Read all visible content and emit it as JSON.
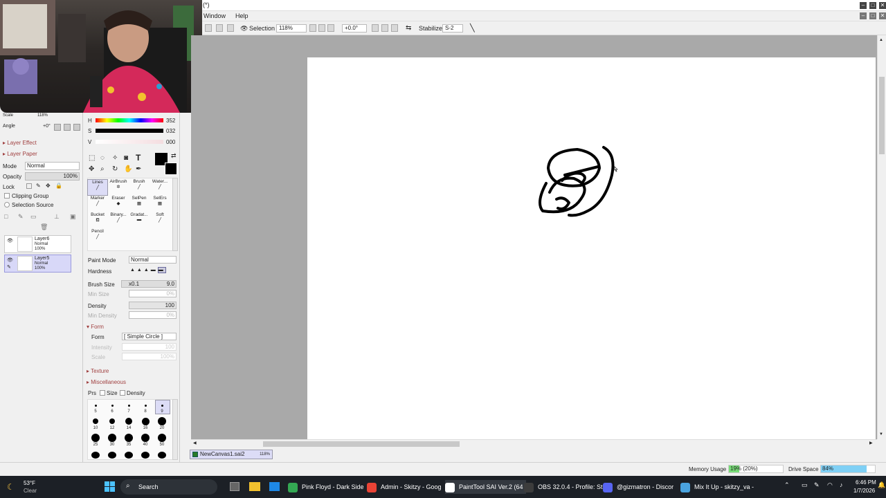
{
  "window": {
    "title_suffix": "(*)"
  },
  "menu": {
    "window": "Window",
    "help": "Help"
  },
  "toolbar": {
    "selection": "Selection",
    "zoom": "118%",
    "rotation": "+0.0°",
    "stabilizer_label": "Stabilizer",
    "stabilizer_value": "S-2"
  },
  "navigator": {
    "scale_label": "Scale",
    "scale_value": "118%",
    "angle_label": "Angle",
    "angle_value": "+0°"
  },
  "layer_panel": {
    "layer_effect": "Layer Effect",
    "layer_paper": "Layer Paper",
    "mode_label": "Mode",
    "mode_value": "Normal",
    "opacity_label": "Opacity",
    "opacity_value": "100%",
    "lock_label": "Lock",
    "clipping_group": "Clipping Group",
    "selection_source": "Selection Source",
    "layers": [
      {
        "name": "Layer6",
        "mode": "Normal",
        "opacity": "100%"
      },
      {
        "name": "Layer5",
        "mode": "Normal",
        "opacity": "100%"
      }
    ]
  },
  "color": {
    "h_label": "H",
    "h": "352",
    "s_label": "S",
    "s": "032",
    "v_label": "V",
    "v": "000",
    "primary": "#000000"
  },
  "tools": {
    "row1": [
      "Lines",
      "AirBrush",
      "Brush",
      "Water..."
    ],
    "row2": [
      "Marker",
      "Eraser",
      "SelPen",
      "SelErs"
    ],
    "row3": [
      "Bucket",
      "Binary...",
      "Gradat...",
      "Soft"
    ],
    "row4": [
      "Pencil"
    ]
  },
  "brush_settings": {
    "paint_mode_label": "Paint Mode",
    "paint_mode_value": "Normal",
    "hardness_label": "Hardness",
    "brush_size_label": "Brush Size",
    "brush_size_mult": "x0.1",
    "brush_size_value": "9.0",
    "min_size_label": "Min Size",
    "min_size_value": "0%",
    "density_label": "Density",
    "density_value": "100",
    "min_density_label": "Min Density",
    "min_density_value": "0%",
    "form_header": "Form",
    "form_label": "Form",
    "form_value": "[ Simple Circle ]",
    "intensity_label": "Intensity",
    "intensity_value": "100",
    "scale_label": "Scale",
    "scale_value": "100%",
    "texture": "Texture",
    "misc": "Miscellaneous",
    "prs_label": "Prs",
    "size_label": "Size",
    "density_chk_label": "Density"
  },
  "brush_sizes": {
    "row1": [
      "5",
      "6",
      "7",
      "8",
      "9"
    ],
    "row2": [
      "10",
      "12",
      "14",
      "16",
      "20"
    ],
    "row3": [
      "25",
      "30",
      "35",
      "40",
      "50"
    ]
  },
  "doc_tab": {
    "name": "NewCanvas1.sai2",
    "zoom": "118%"
  },
  "status": {
    "memory_label": "Memory Usage",
    "memory_value": "19% (20%)",
    "memory_fraction": 0.19,
    "drive_label": "Drive Space",
    "drive_value": "84%",
    "drive_fraction": 0.84
  },
  "taskbar": {
    "weather_temp": "53°F",
    "weather_desc": "Clear",
    "search": "Search",
    "apps": [
      {
        "label": "Pink Floyd - Dark Side",
        "color": "#34a853"
      },
      {
        "label": "Admin - Skitzy - Goog",
        "color": "#ea4335"
      },
      {
        "label": "PaintTool SAI Ver.2 (64",
        "color": "#ffffff"
      },
      {
        "label": "OBS 32.0.4 - Profile: St",
        "color": "#3c3c3c"
      },
      {
        "label": "@gizmatron - Discor",
        "color": "#5865f2"
      },
      {
        "label": "Mix It Up - skitzy_va -",
        "color": "#4aa3df"
      }
    ],
    "time": "6:46 PM",
    "date": "1/7/2026"
  }
}
